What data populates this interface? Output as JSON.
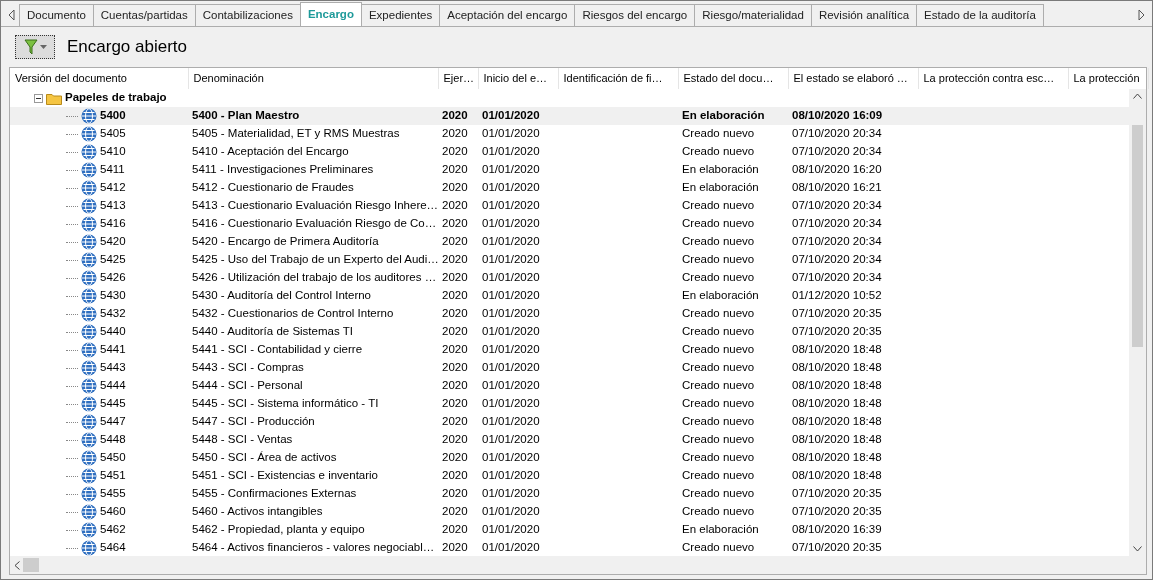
{
  "tabs": [
    {
      "label": "Documento",
      "selected": false
    },
    {
      "label": "Cuentas/partidas",
      "selected": false
    },
    {
      "label": "Contabilizaciones",
      "selected": false
    },
    {
      "label": "Encargo",
      "selected": true
    },
    {
      "label": "Expedientes",
      "selected": false
    },
    {
      "label": "Aceptación del encargo",
      "selected": false
    },
    {
      "label": "Riesgos del encargo",
      "selected": false
    },
    {
      "label": "Riesgo/materialidad",
      "selected": false
    },
    {
      "label": "Revisión analítica",
      "selected": false
    },
    {
      "label": "Estado de la auditoría",
      "selected": false
    }
  ],
  "toolbar": {
    "title": "Encargo abierto"
  },
  "table": {
    "columns": [
      "Versión del documento",
      "Denominación",
      "Ejer…",
      "Inicio del e…",
      "Identificación de fi…",
      "Estado del docu…",
      "El estado se elaboró …",
      "La protección contra esc…",
      "La protección"
    ],
    "group": {
      "label": "Papeles de trabajo",
      "expanded": true,
      "rows": [
        {
          "version": "5400",
          "name": "5400 - Plan Maestro",
          "year": "2020",
          "start": "01/01/2020",
          "status": "En elaboración",
          "date": "08/10/2020 16:09",
          "selected": true
        },
        {
          "version": "5405",
          "name": "5405 - Materialidad, ET y RMS Muestras",
          "year": "2020",
          "start": "01/01/2020",
          "status": "Creado nuevo",
          "date": "07/10/2020 20:34",
          "selected": false
        },
        {
          "version": "5410",
          "name": "5410 - Aceptación del Encargo",
          "year": "2020",
          "start": "01/01/2020",
          "status": "Creado nuevo",
          "date": "07/10/2020 20:34",
          "selected": false
        },
        {
          "version": "5411",
          "name": "5411 - Investigaciones Preliminares",
          "year": "2020",
          "start": "01/01/2020",
          "status": "En elaboración",
          "date": "08/10/2020 16:20",
          "selected": false
        },
        {
          "version": "5412",
          "name": "5412 - Cuestionario de Fraudes",
          "year": "2020",
          "start": "01/01/2020",
          "status": "En elaboración",
          "date": "08/10/2020 16:21",
          "selected": false
        },
        {
          "version": "5413",
          "name": "5413 - Cuestionario Evaluación Riesgo Inhere…",
          "year": "2020",
          "start": "01/01/2020",
          "status": "Creado nuevo",
          "date": "07/10/2020 20:34",
          "selected": false
        },
        {
          "version": "5416",
          "name": "5416 - Cuestionario Evaluación Riesgo de Co…",
          "year": "2020",
          "start": "01/01/2020",
          "status": "Creado nuevo",
          "date": "07/10/2020 20:34",
          "selected": false
        },
        {
          "version": "5420",
          "name": "5420 - Encargo de Primera Auditoría",
          "year": "2020",
          "start": "01/01/2020",
          "status": "Creado nuevo",
          "date": "07/10/2020 20:34",
          "selected": false
        },
        {
          "version": "5425",
          "name": "5425 - Uso del Trabajo de un Experto del Audi…",
          "year": "2020",
          "start": "01/01/2020",
          "status": "Creado nuevo",
          "date": "07/10/2020 20:34",
          "selected": false
        },
        {
          "version": "5426",
          "name": "5426 - Utilización del trabajo de los auditores …",
          "year": "2020",
          "start": "01/01/2020",
          "status": "Creado nuevo",
          "date": "07/10/2020 20:34",
          "selected": false
        },
        {
          "version": "5430",
          "name": "5430 - Auditoría del Control Interno",
          "year": "2020",
          "start": "01/01/2020",
          "status": "En elaboración",
          "date": "01/12/2020 10:52",
          "selected": false
        },
        {
          "version": "5432",
          "name": "5432 - Cuestionarios de Control Interno",
          "year": "2020",
          "start": "01/01/2020",
          "status": "Creado nuevo",
          "date": "07/10/2020 20:35",
          "selected": false
        },
        {
          "version": "5440",
          "name": "5440 - Auditoría de Sistemas TI",
          "year": "2020",
          "start": "01/01/2020",
          "status": "Creado nuevo",
          "date": "07/10/2020 20:35",
          "selected": false
        },
        {
          "version": "5441",
          "name": "5441 - SCI - Contabilidad y cierre",
          "year": "2020",
          "start": "01/01/2020",
          "status": "Creado nuevo",
          "date": "08/10/2020 18:48",
          "selected": false
        },
        {
          "version": "5443",
          "name": "5443 - SCI - Compras",
          "year": "2020",
          "start": "01/01/2020",
          "status": "Creado nuevo",
          "date": "08/10/2020 18:48",
          "selected": false
        },
        {
          "version": "5444",
          "name": "5444 - SCI - Personal",
          "year": "2020",
          "start": "01/01/2020",
          "status": "Creado nuevo",
          "date": "08/10/2020 18:48",
          "selected": false
        },
        {
          "version": "5445",
          "name": "5445 - SCI - Sistema informático - TI",
          "year": "2020",
          "start": "01/01/2020",
          "status": "Creado nuevo",
          "date": "08/10/2020 18:48",
          "selected": false
        },
        {
          "version": "5447",
          "name": "5447 - SCI - Producción",
          "year": "2020",
          "start": "01/01/2020",
          "status": "Creado nuevo",
          "date": "08/10/2020 18:48",
          "selected": false
        },
        {
          "version": "5448",
          "name": "5448 - SCI - Ventas",
          "year": "2020",
          "start": "01/01/2020",
          "status": "Creado nuevo",
          "date": "08/10/2020 18:48",
          "selected": false
        },
        {
          "version": "5450",
          "name": "5450 - SCI - Área de activos",
          "year": "2020",
          "start": "01/01/2020",
          "status": "Creado nuevo",
          "date": "08/10/2020 18:48",
          "selected": false
        },
        {
          "version": "5451",
          "name": "5451 - SCI - Existencias e inventario",
          "year": "2020",
          "start": "01/01/2020",
          "status": "Creado nuevo",
          "date": "08/10/2020 18:48",
          "selected": false
        },
        {
          "version": "5455",
          "name": "5455 - Confirmaciones Externas",
          "year": "2020",
          "start": "01/01/2020",
          "status": "Creado nuevo",
          "date": "07/10/2020 20:35",
          "selected": false
        },
        {
          "version": "5460",
          "name": "5460 - Activos intangibles",
          "year": "2020",
          "start": "01/01/2020",
          "status": "Creado nuevo",
          "date": "07/10/2020 20:35",
          "selected": false
        },
        {
          "version": "5462",
          "name": "5462 - Propiedad, planta y equipo",
          "year": "2020",
          "start": "01/01/2020",
          "status": "En elaboración",
          "date": "08/10/2020 16:39",
          "selected": false
        },
        {
          "version": "5464",
          "name": "5464 - Activos financieros - valores negociabl…",
          "year": "2020",
          "start": "01/01/2020",
          "status": "Creado nuevo",
          "date": "07/10/2020 20:35",
          "selected": false
        }
      ]
    }
  }
}
